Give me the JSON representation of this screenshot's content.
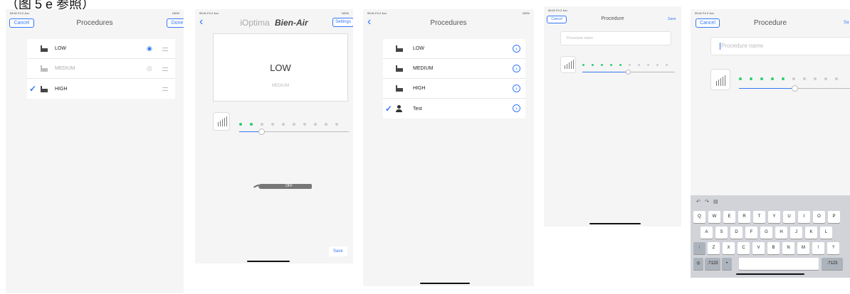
{
  "caption": "（图 5 e 参照）",
  "screen1": {
    "status_time": "09:41 Fri 2 Jun",
    "status_battery": "100%",
    "cancel_label": "Cancel",
    "title": "Procedures",
    "done_label": "Done",
    "rows": [
      {
        "label": "LOW",
        "checked": false,
        "visible": true
      },
      {
        "label": "MEDIUM",
        "checked": false,
        "visible": false
      },
      {
        "label": "HIGH",
        "checked": true,
        "visible": null
      }
    ]
  },
  "screen2": {
    "status_time": "09:41 Fri 2 Jun",
    "status_battery": "100%",
    "title": "iOptima",
    "brand": "Bien-Air",
    "settings_label": "Settings",
    "current_procedure": "LOW",
    "next_procedure": "MEDIUM",
    "motor_state": "OFF",
    "save_label": "Save",
    "level": 2,
    "level_max": 10
  },
  "screen3": {
    "status_time": "09:41 Fri 2 Jun",
    "status_battery": "100%",
    "title": "Procedures",
    "rows": [
      {
        "label": "LOW",
        "icon": "factory-icon",
        "checked": false
      },
      {
        "label": "MEDIUM",
        "icon": "factory-icon",
        "checked": false
      },
      {
        "label": "HIGH",
        "icon": "factory-icon",
        "checked": false
      },
      {
        "label": "Test",
        "icon": "user-icon",
        "checked": true
      }
    ]
  },
  "screen4": {
    "status_time": "09:41 Fri 2 Jun",
    "cancel_label": "Cancel",
    "title": "Procedure",
    "save_label": "Save",
    "name_placeholder": "Procedure name",
    "level": 5,
    "level_max": 10
  },
  "screen5": {
    "status_time": "09:41 Fri 2 Jun",
    "cancel_label": "Cancel",
    "title": "Procedure",
    "save_label": "Sa",
    "name_placeholder": "Procedure name",
    "level": 5,
    "level_max": 10,
    "keyboard": {
      "row1": [
        "Q",
        "W",
        "E",
        "R",
        "T",
        "Y",
        "U",
        "I",
        "O",
        "P"
      ],
      "row2": [
        "A",
        "S",
        "D",
        "F",
        "G",
        "H",
        "J",
        "K",
        "L"
      ],
      "row3": [
        "Z",
        "X",
        "C",
        "V",
        "B",
        "N",
        "M",
        "!",
        "?"
      ],
      "numbers_label": ".?123"
    }
  },
  "colors": {
    "accent": "#3478f6",
    "active_dot": "#2ecc71"
  }
}
